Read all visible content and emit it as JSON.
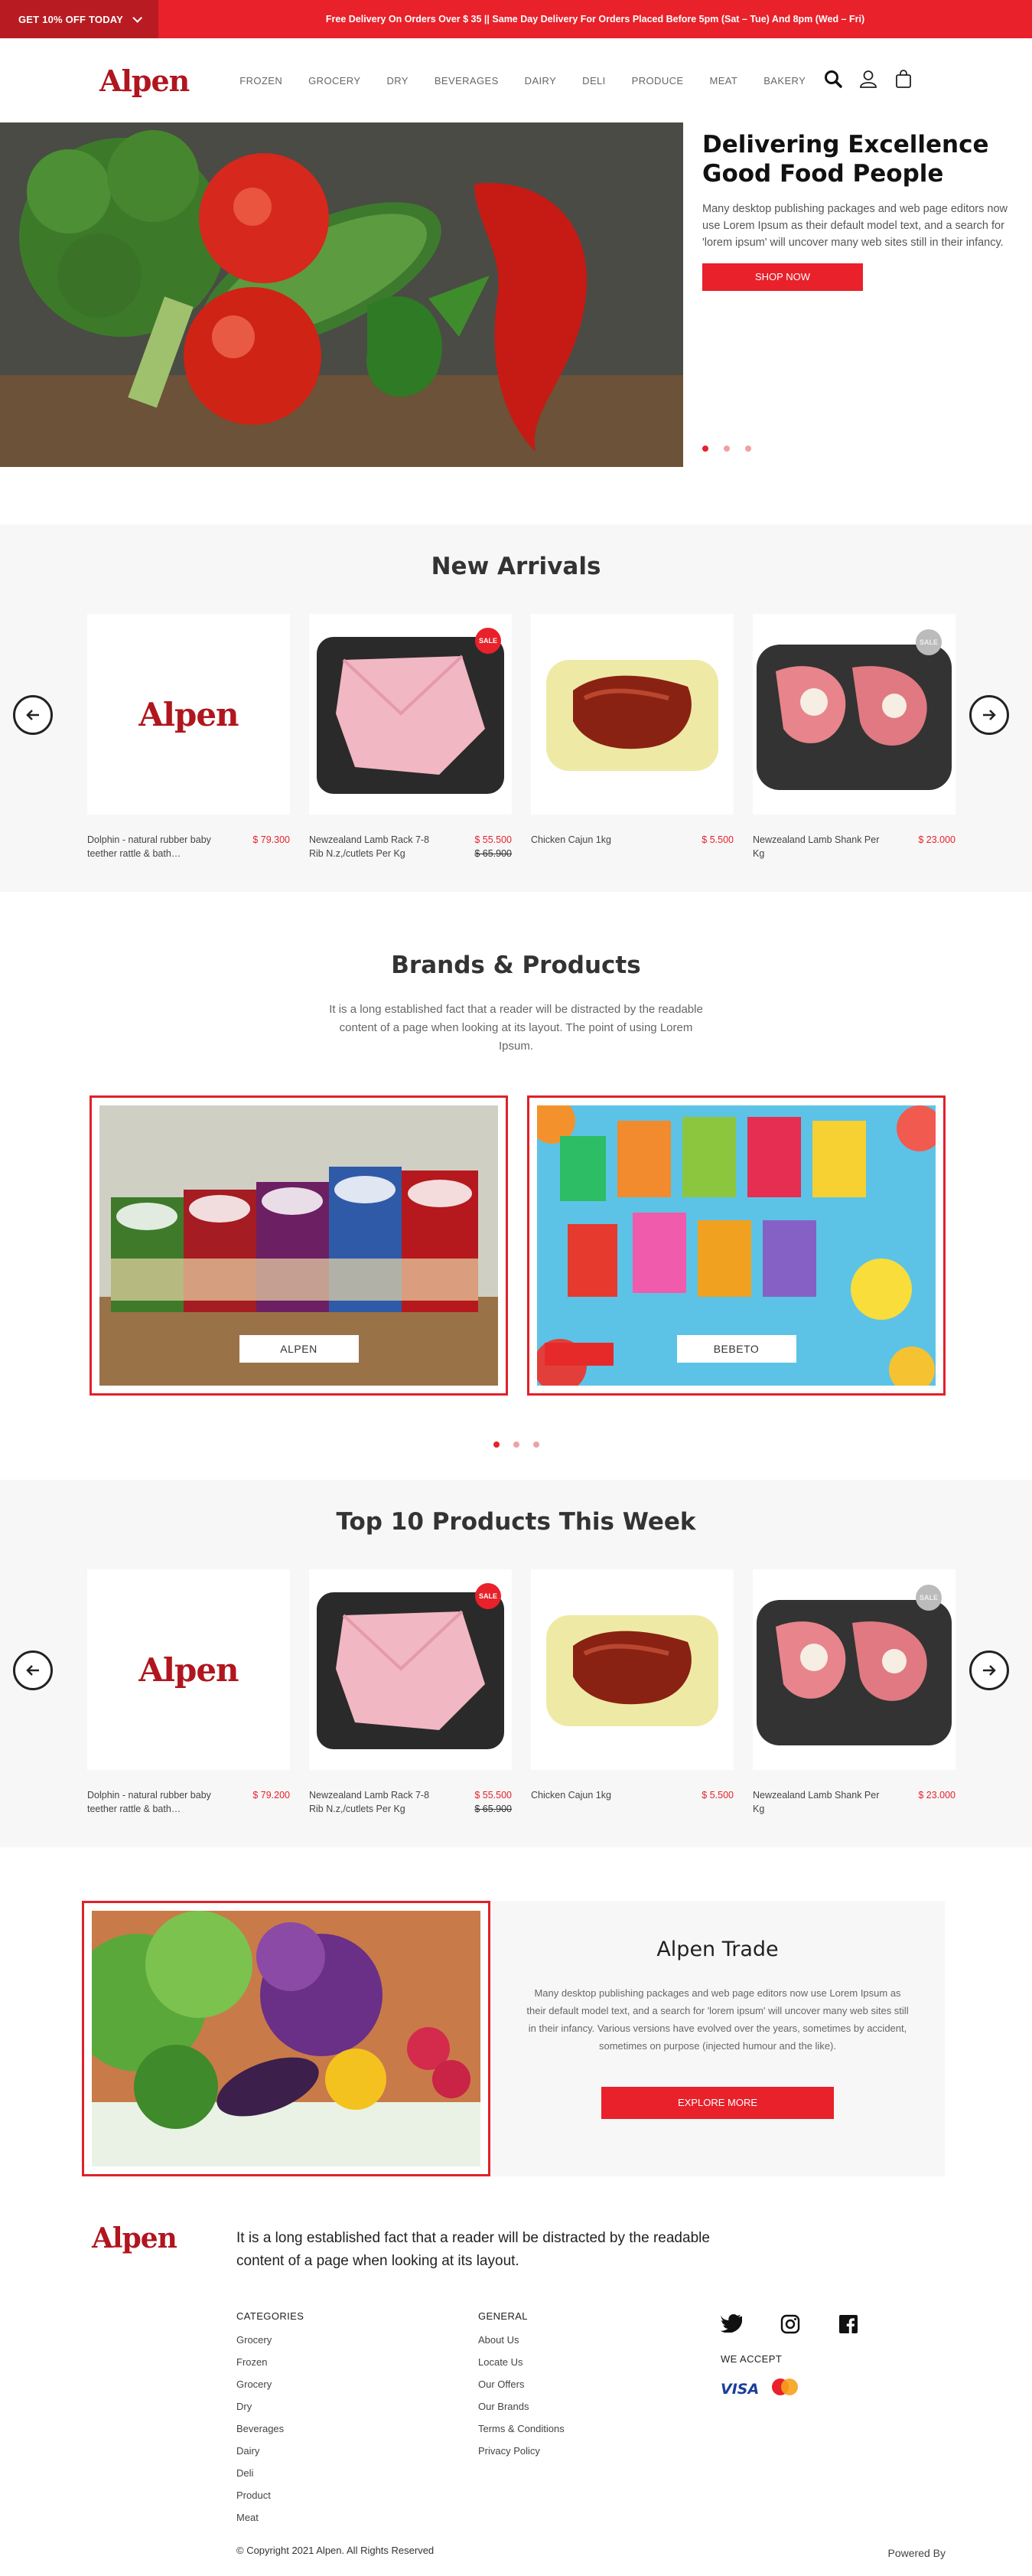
{
  "topbar": {
    "offer": "GET 10% OFF TODAY",
    "message": "Free Delivery On Orders Over $ 35 || Same Day Delivery For Orders Placed Before 5pm (Sat – Tue) And 8pm (Wed – Fri)"
  },
  "header": {
    "logo": "Alpen",
    "nav": [
      "FROZEN",
      "GROCERY",
      "DRY",
      "BEVERAGES",
      "DAIRY",
      "DELI",
      "PRODUCE",
      "MEAT",
      "BAKERY"
    ]
  },
  "hero": {
    "title": "Delivering Excellence Good Food People",
    "body": "Many desktop publishing packages and web page editors now use Lorem Ipsum as their default model text, and a search for 'lorem ipsum' will uncover many web sites still in their infancy.",
    "button": "SHOP NOW"
  },
  "new_arrivals": {
    "title": "New Arrivals",
    "products": [
      {
        "name": "Dolphin - natural rubber baby teether rattle & bath…",
        "price": "$ 79.300",
        "old_price": ""
      },
      {
        "name": "Newzealand Lamb Rack 7-8 Rib N.z,/cutlets Per Kg",
        "price": "$ 55.500",
        "old_price": "$ 65.900"
      },
      {
        "name": "Chicken Cajun 1kg",
        "price": "$ 5.500",
        "old_price": ""
      },
      {
        "name": "Newzealand Lamb Shank Per Kg",
        "price": "$ 23.000",
        "old_price": ""
      }
    ],
    "sale_badge": "SALE"
  },
  "brands": {
    "title": "Brands & Products",
    "lead": "It is a long established fact that a reader will be distracted by the readable content of a page when looking at its layout. The point of using Lorem Ipsum.",
    "cards": [
      {
        "label": "ALPEN"
      },
      {
        "label": "BEBETO"
      }
    ]
  },
  "top10": {
    "title": "Top 10 Products This Week",
    "products": [
      {
        "name": "Dolphin - natural rubber baby teether rattle & bath…",
        "price": "$ 79.200",
        "old_price": ""
      },
      {
        "name": "Newzealand Lamb Rack 7-8 Rib N.z,/cutlets Per Kg",
        "price": "$ 55.500",
        "old_price": "$ 65.900"
      },
      {
        "name": "Chicken Cajun 1kg",
        "price": "$ 5.500",
        "old_price": ""
      },
      {
        "name": "Newzealand Lamb Shank Per Kg",
        "price": "$ 23.000",
        "old_price": ""
      }
    ],
    "sale_badge": "SALE"
  },
  "trade": {
    "title": "Alpen Trade",
    "body": "Many desktop publishing packages and web page editors now use Lorem Ipsum as their default model text, and a search for 'lorem ipsum' will uncover many web sites still in their infancy. Various versions have evolved over the years, sometimes by accident, sometimes on purpose (injected humour and the like).",
    "button": "EXPLORE MORE"
  },
  "footer": {
    "logo": "Alpen",
    "lead": "It is a long established fact that a reader will be distracted by the readable content of a page when looking at its layout.",
    "categories_title": "CATEGORIES",
    "categories": [
      "Grocery",
      "Frozen",
      "Grocery",
      "Dry",
      "Beverages",
      "Dairy",
      "Deli",
      "Product",
      "Meat"
    ],
    "general_title": "GENERAL",
    "general": [
      "About Us",
      "Locate Us",
      "Our Offers",
      "Our Brands",
      "Terms & Conditions",
      "Privacy Policy"
    ],
    "we_accept": "WE ACCEPT",
    "visa": "VISA",
    "copyright": "© Copyright 2021 Alpen. All Rights Reserved",
    "powered": "Powered By"
  },
  "colors": {
    "brand_red": "#e8212a",
    "logo_red": "#b0161e",
    "section_grey": "#f7f7f7"
  }
}
